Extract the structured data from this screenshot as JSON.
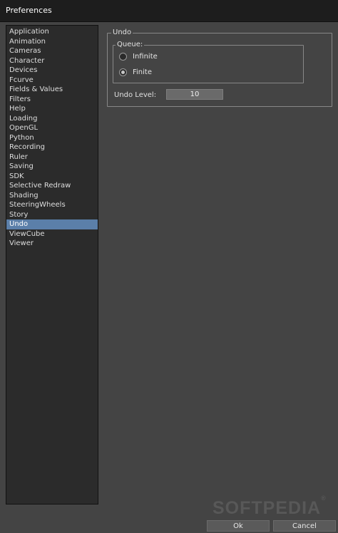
{
  "window": {
    "title": "Preferences"
  },
  "sidebar": {
    "items": [
      {
        "label": "Application"
      },
      {
        "label": "Animation"
      },
      {
        "label": "Cameras"
      },
      {
        "label": "Character"
      },
      {
        "label": "Devices"
      },
      {
        "label": "Fcurve"
      },
      {
        "label": "Fields & Values"
      },
      {
        "label": "Filters"
      },
      {
        "label": "Help"
      },
      {
        "label": "Loading"
      },
      {
        "label": "OpenGL"
      },
      {
        "label": "Python"
      },
      {
        "label": "Recording"
      },
      {
        "label": "Ruler"
      },
      {
        "label": "Saving"
      },
      {
        "label": "SDK"
      },
      {
        "label": "Selective Redraw"
      },
      {
        "label": "Shading"
      },
      {
        "label": "SteeringWheels"
      },
      {
        "label": "Story"
      },
      {
        "label": "Undo"
      },
      {
        "label": "ViewCube"
      },
      {
        "label": "Viewer"
      }
    ],
    "selected": "Undo"
  },
  "undo": {
    "group_title": "Undo",
    "queue": {
      "title": "Queue:",
      "options": [
        "Infinite",
        "Finite"
      ],
      "selected": "Finite"
    },
    "level_label": "Undo Level:",
    "level_value": "10"
  },
  "watermark": {
    "text": "SOFTPEDIA",
    "mark": "®"
  },
  "buttons": {
    "ok": "Ok",
    "cancel": "Cancel"
  },
  "colors": {
    "selection": "#5b7fa9",
    "background": "#444444",
    "titlebar": "#1d1d1d"
  }
}
